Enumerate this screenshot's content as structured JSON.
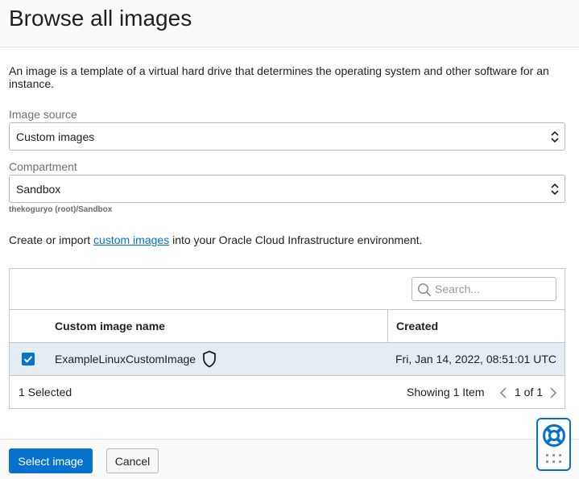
{
  "header": {
    "title": "Browse all images"
  },
  "intro": "An image is a template of a virtual hard drive that determines the operating system and other software for an instance.",
  "image_source": {
    "label": "Image source",
    "value": "Custom images"
  },
  "compartment": {
    "label": "Compartment",
    "value": "Sandbox",
    "path": "thekoguryo (root)/Sandbox"
  },
  "import_text": {
    "before": "Create or import ",
    "link": "custom images",
    "after": " into your Oracle Cloud Infrastructure environment."
  },
  "table": {
    "search_placeholder": "Search...",
    "columns": [
      "Custom image name",
      "Created"
    ],
    "rows": [
      {
        "name": "ExampleLinuxCustomImage",
        "created": "Fri, Jan 14, 2022, 08:51:01 UTC",
        "selected": true
      }
    ],
    "selected_text": "1 Selected",
    "showing_text": "Showing 1 Item",
    "page_text": "1 of 1"
  },
  "actions": {
    "primary": "Select image",
    "secondary": "Cancel"
  },
  "colors": {
    "accent": "#0572ce",
    "row_selected": "#e4edf4"
  },
  "icons": [
    "chevron-updown-icon",
    "search-icon",
    "checkmark-icon",
    "shield-icon",
    "chevron-left-icon",
    "chevron-right-icon",
    "lifebuoy-icon",
    "grip-icon"
  ]
}
